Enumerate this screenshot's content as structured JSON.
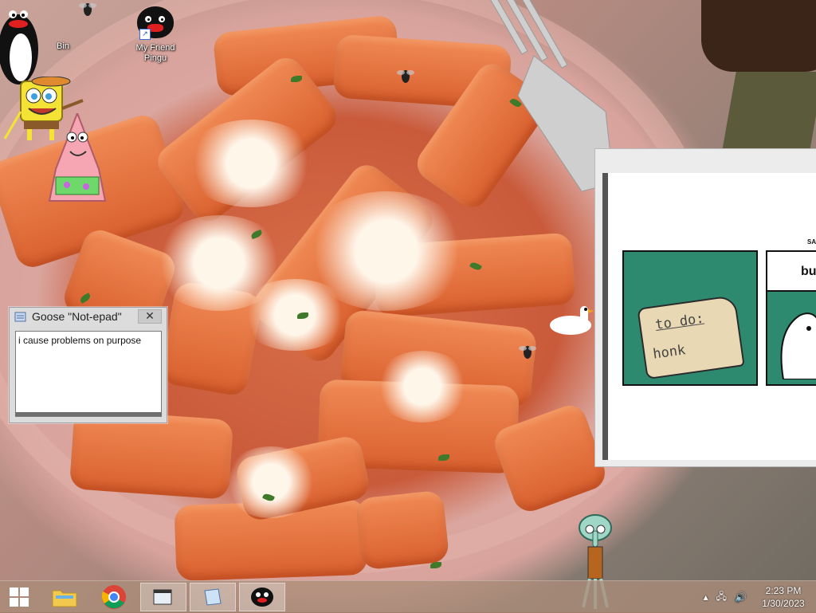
{
  "desktop": {
    "icons": [
      {
        "label": "Bin"
      },
      {
        "label": "My Friend\nPingu"
      }
    ]
  },
  "notepad": {
    "title": "Goose \"Not-epad\"",
    "close_label": "✕",
    "content": "i cause problems on purpose"
  },
  "meme": {
    "header_text": "SAFEG",
    "bubble_text": "bus",
    "scroll_title": "to do:",
    "scroll_item": "honk"
  },
  "taskbar": {
    "buttons": [
      {
        "name": "start",
        "icon": "windows-logo-icon"
      },
      {
        "name": "file-explorer",
        "icon": "folder-icon"
      },
      {
        "name": "chrome",
        "icon": "chrome-icon"
      },
      {
        "name": "window-1",
        "icon": "window-icon"
      },
      {
        "name": "notepad",
        "icon": "notepad-icon"
      },
      {
        "name": "pingu",
        "icon": "pingu-icon"
      }
    ],
    "tray": {
      "chevron": "▴",
      "network": "🖧",
      "volume": "🔊"
    },
    "clock": {
      "time": "2:23 PM",
      "date": "1/30/2023"
    }
  },
  "colors": {
    "taskbar": "#aa8c78",
    "meme_green": "#2e8a6e",
    "pingu_beak": "#e02020"
  }
}
